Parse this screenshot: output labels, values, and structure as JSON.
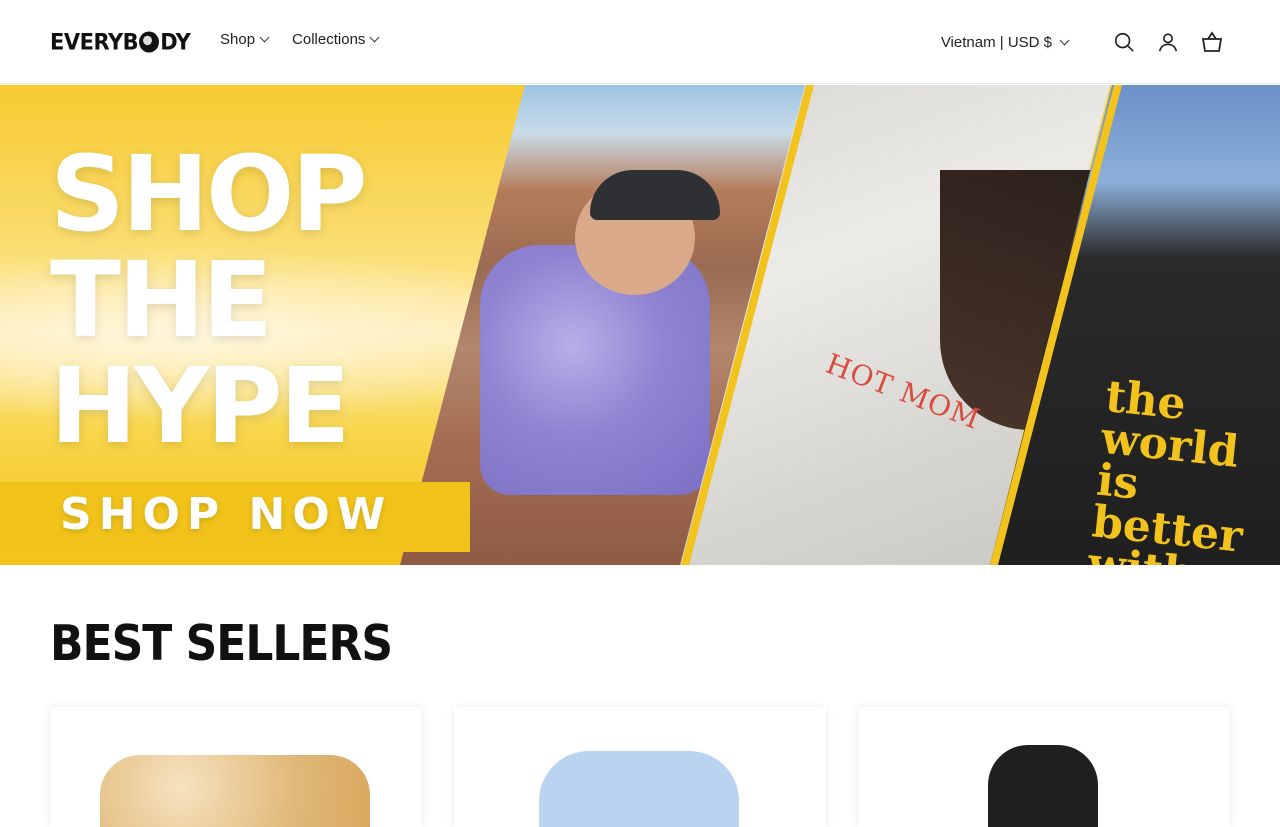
{
  "header": {
    "brand": "EVERYBODY",
    "nav": [
      {
        "label": "Shop"
      },
      {
        "label": "Collections"
      }
    ],
    "locale": "Vietnam | USD $",
    "icons": [
      "search-icon",
      "account-icon",
      "cart-icon"
    ]
  },
  "hero": {
    "headline": [
      "SHOP",
      "THE",
      "HYPE"
    ],
    "cta": "SHOP NOW",
    "shirt_texts": [
      "HOT MOM",
      "the world is better with you in it"
    ]
  },
  "best_sellers": {
    "title": "BEST SELLERS",
    "product_count_visible": 3
  },
  "colors": {
    "accent_yellow": "#f2c21d",
    "text": "#111111",
    "background": "#ffffff"
  }
}
